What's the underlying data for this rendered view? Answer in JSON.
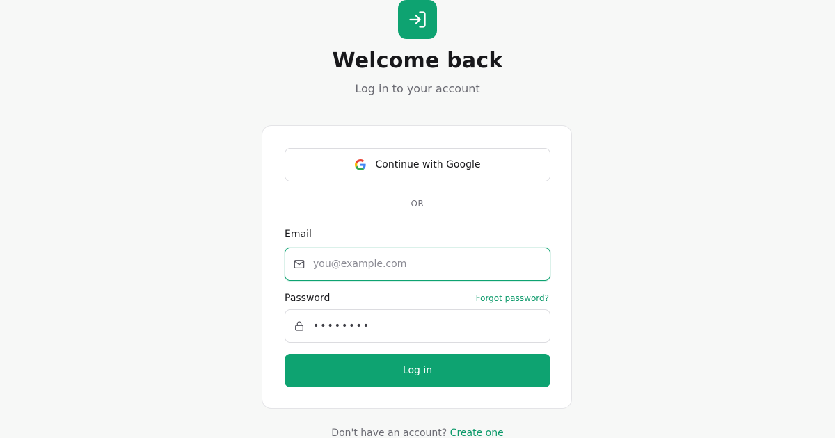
{
  "header": {
    "title": "Welcome back",
    "subtitle": "Log in to your account",
    "logo_icon": "login-icon"
  },
  "oauth": {
    "google_label": "Continue with Google",
    "google_icon": "google-icon"
  },
  "divider": {
    "label": "OR"
  },
  "form": {
    "email_label": "Email",
    "email_placeholder": "you@example.com",
    "email_value": "",
    "email_icon": "mail-icon",
    "password_label": "Password",
    "password_value": "••••••••",
    "password_icon": "lock-icon",
    "forgot_label": "Forgot password?",
    "submit_label": "Log in"
  },
  "footer": {
    "prompt": "Don't have an account?",
    "link_label": "Create one"
  },
  "colors": {
    "accent": "#0ea371",
    "background": "#f7f8f7",
    "card": "#ffffff"
  }
}
